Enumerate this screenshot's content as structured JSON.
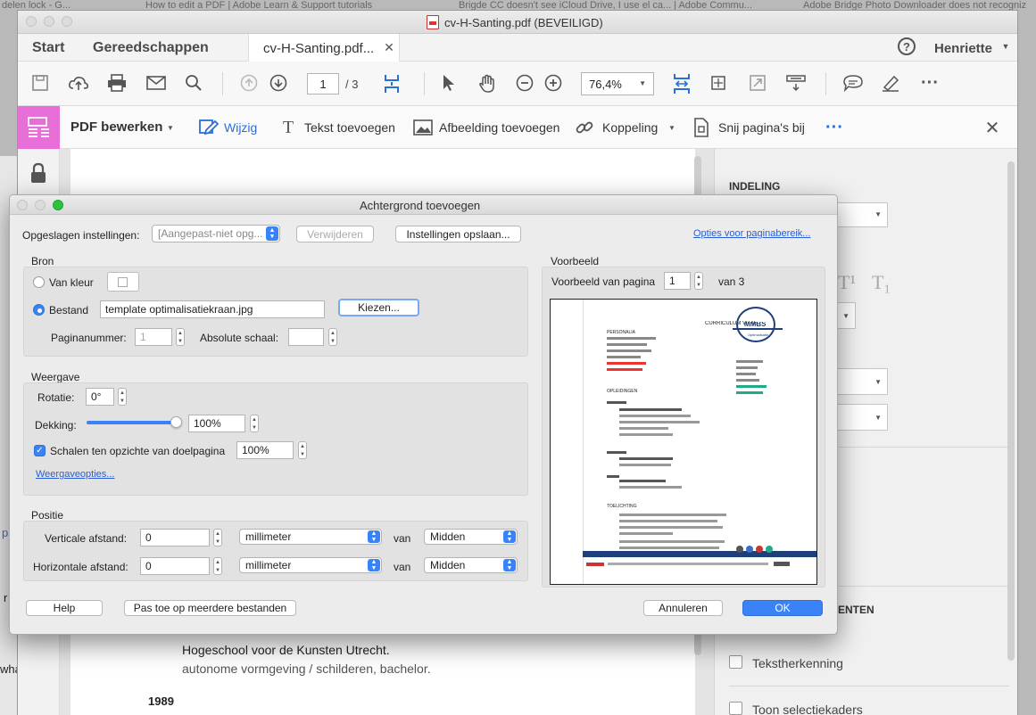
{
  "browser_tabs": [
    "delen lock - G...",
    "How to edit a PDF | Adobe Learn & Support tutorials",
    "Brigde CC doesn't see iCloud Drive, I use el ca... | Adobe Commu...",
    "Adobe Bridge Photo Downloader does not recogniz"
  ],
  "window": {
    "title": "cv-H-Santing.pdf (BEVEILIGD)"
  },
  "menubar": {
    "start": "Start",
    "tools": "Gereedschappen",
    "doc_tab": "cv-H-Santing.pdf...",
    "user": "Henriette"
  },
  "toolbar": {
    "page": "1",
    "page_total": "/ 3",
    "zoom": "76,4%"
  },
  "edit_bar": {
    "title": "PDF bewerken",
    "edit": "Wijzig",
    "add_text": "Tekst toevoegen",
    "add_image": "Afbeelding toevoegen",
    "link": "Koppeling",
    "crop": "Snij pagina's bij"
  },
  "right_panel": {
    "section": "INDELING",
    "section2": "ENTEN",
    "ocr": "Tekstherkenning",
    "frames": "Toon selectiekaders"
  },
  "left_edge": {
    "text1": "r",
    "text2": "wha",
    "text3": "p"
  },
  "background_doc": {
    "line1": "Hogeschool voor de Kunsten Utrecht.",
    "line2": "autonome vormgeving / schilderen, bachelor.",
    "year": "1989"
  },
  "dialog": {
    "title": "Achtergrond toevoegen",
    "saved_label": "Opgeslagen instellingen:",
    "saved_value": "[Aangepast-niet opg...",
    "delete": "Verwijderen",
    "save": "Instellingen opslaan...",
    "page_range": "Opties voor paginabereik...",
    "source": {
      "heading": "Bron",
      "from_color": "Van kleur",
      "file": "Bestand",
      "file_value": "template optimalisatiekraan.jpg",
      "choose": "Kiezen...",
      "page_no_label": "Paginanummer:",
      "page_no": "1",
      "scale_label": "Absolute schaal:",
      "scale": ""
    },
    "appearance": {
      "heading": "Weergave",
      "rotation_label": "Rotatie:",
      "rotation": "0°",
      "opacity_label": "Dekking:",
      "opacity": "100%",
      "opacity_fraction": 1.0,
      "scale_label": "Schalen ten opzichte van doelpagina",
      "scale": "100%",
      "options": "Weergaveopties..."
    },
    "position": {
      "heading": "Positie",
      "vertical_label": "Verticale afstand:",
      "vertical": "0",
      "horizontal_label": "Horizontale afstand:",
      "horizontal": "0",
      "unit": "millimeter",
      "of": "van",
      "anchor": "Midden"
    },
    "preview": {
      "heading": "Voorbeeld",
      "page_label": "Voorbeeld van pagina",
      "page": "1",
      "of": "van 3"
    },
    "help": "Help",
    "apply_multiple": "Pas toe op meerdere bestanden",
    "cancel": "Annuleren",
    "ok": "OK"
  },
  "preview_doc": {
    "header": "CURRICULUM VITAE",
    "logo": "MMBS",
    "logo_sub": "Optimalisatie",
    "personal": "PERSONALIA",
    "education": "OPLEIDINGEN",
    "notes": "TOELICHTING"
  },
  "colors": {
    "accent": "#3a83f7",
    "edit_pink": "#e86fd8",
    "link": "#2a5fd0"
  }
}
